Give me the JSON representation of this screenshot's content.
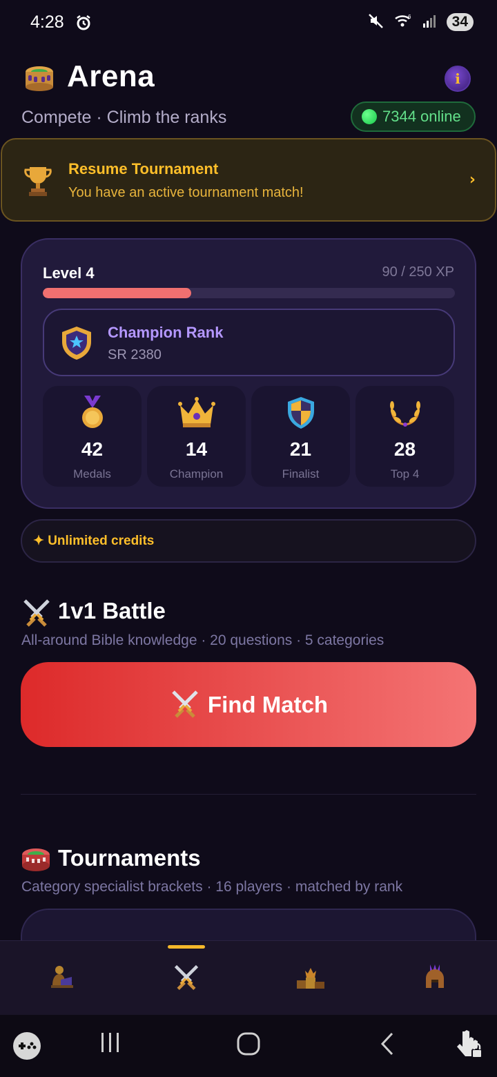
{
  "status_bar": {
    "time": "4:28",
    "battery": "34",
    "icons": [
      "alarm-icon",
      "mute-icon",
      "wifi-icon",
      "signal-icon"
    ]
  },
  "header": {
    "title": "Arena",
    "subtitle": "Compete · Climb the ranks",
    "online": "7344 online",
    "info_icon": "info-icon",
    "header_icon": "colosseum-icon"
  },
  "resume_banner": {
    "title": "Resume Tournament",
    "subtitle": "You have an active tournament match!",
    "chevron": "›",
    "icon": "trophy-icon"
  },
  "level": {
    "label": "Level 4",
    "xp_text": "90 / 250 XP",
    "xp_current": 90,
    "xp_max": 250
  },
  "rank": {
    "title": "Champion Rank",
    "sr": "SR 2380",
    "icon": "shield-star-icon"
  },
  "stats": [
    {
      "value": "42",
      "label": "Medals",
      "icon": "medal-icon"
    },
    {
      "value": "14",
      "label": "Champion",
      "icon": "crown-icon"
    },
    {
      "value": "21",
      "label": "Finalist",
      "icon": "shield-icon"
    },
    {
      "value": "28",
      "label": "Top 4",
      "icon": "laurel-icon"
    }
  ],
  "credits": {
    "text": "✦ Unlimited credits"
  },
  "battle": {
    "title": "1v1 Battle",
    "subtitle": "All-around Bible knowledge · 20 questions · 5 categories",
    "button_label": "Find Match"
  },
  "tournaments": {
    "title": "Tournaments",
    "subtitle": "Category specialist brackets · 16 players · matched by rank"
  },
  "tabs": [
    {
      "icon": "reader-icon",
      "active": false
    },
    {
      "icon": "swords-icon",
      "active": true
    },
    {
      "icon": "podium-icon",
      "active": false
    },
    {
      "icon": "helmet-icon",
      "active": false
    }
  ],
  "colors": {
    "accent_gold": "#ffbf2a",
    "accent_red": "#dd2a2a",
    "background": "#0f0b1a",
    "card": "#211a3b",
    "rank_purple": "#b497ff",
    "online_green": "#63e08a"
  }
}
